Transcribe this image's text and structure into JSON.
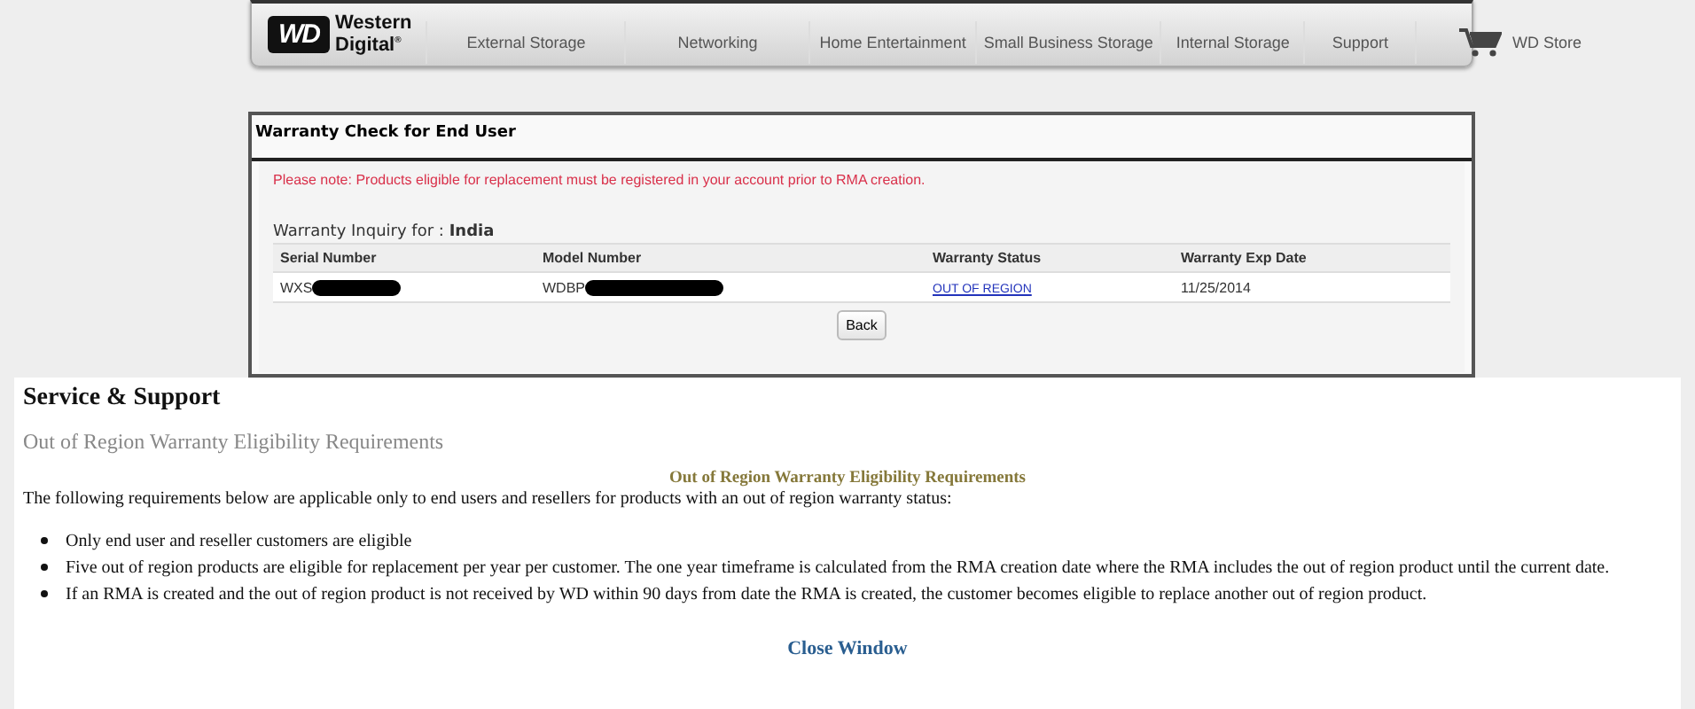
{
  "nav": {
    "logo": {
      "mark": "WD",
      "line1": "Western",
      "line2": "Digital",
      "reg": "®"
    },
    "items": [
      {
        "label": "External Storage"
      },
      {
        "label": "Networking"
      },
      {
        "label": "Home Entertainment"
      },
      {
        "label": "Small Business Storage"
      },
      {
        "label": "Internal Storage"
      },
      {
        "label": "Support"
      },
      {
        "label": "WD Store",
        "kind": "cart"
      }
    ]
  },
  "warranty": {
    "title": "Warranty Check for End User",
    "notice": "Please note: Products eligible for replacement must be registered in your account prior to RMA creation.",
    "inquiry_label": "Warranty Inquiry for : ",
    "inquiry_country": "India",
    "table": {
      "columns": [
        "Serial Number",
        "Model Number",
        "Warranty Status",
        "Warranty Exp Date"
      ],
      "rows": [
        {
          "serial": "WXS",
          "serial_redacted": true,
          "model": "WDBP",
          "model_redacted": true,
          "status": "OUT OF REGION",
          "exp": "11/25/2014"
        }
      ]
    },
    "button": "Back"
  },
  "support": {
    "title": "Service & Support",
    "subtitle": "Out of Region Warranty Eligibility Requirements",
    "heading": "Out of Region Warranty Eligibility Requirements",
    "intro": "The following requirements below are applicable only to end users and resellers for products with an out of region warranty status:",
    "bullets": [
      "Only end user and reseller customers are eligible",
      "Five out of region products are eligible for replacement per year per customer. The one year timeframe is calculated from the RMA creation date where the RMA includes the out of region product until the current date.",
      "If an RMA is created and the out of region product is not received by WD within 90 days from date the RMA is created, the customer becomes eligible to replace another out of region product."
    ],
    "close": "Close Window"
  }
}
